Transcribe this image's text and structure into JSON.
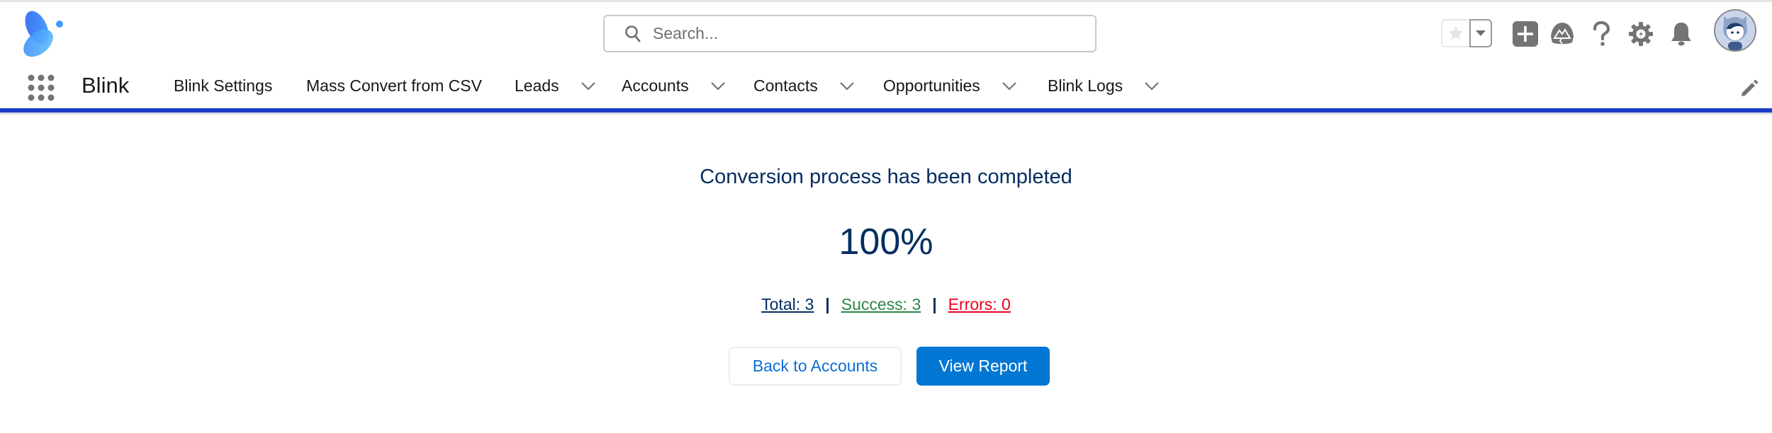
{
  "header": {
    "logo": "blink-butterfly-logo",
    "search": {
      "placeholder": "Search...",
      "value": ""
    },
    "icons": [
      "favorite-star-icon",
      "favorites-dropdown-icon",
      "global-create-icon",
      "trailhead-icon",
      "help-icon",
      "setup-gear-icon",
      "notifications-bell-icon",
      "user-avatar"
    ]
  },
  "nav": {
    "app_name": "Blink",
    "items": [
      {
        "label": "Blink Settings",
        "has_menu": false
      },
      {
        "label": "Mass Convert from CSV",
        "has_menu": false
      },
      {
        "label": "Leads",
        "has_menu": true
      },
      {
        "label": "Accounts",
        "has_menu": true
      },
      {
        "label": "Contacts",
        "has_menu": true
      },
      {
        "label": "Opportunities",
        "has_menu": true
      },
      {
        "label": "Blink Logs",
        "has_menu": true
      }
    ],
    "accent_color": "#1b3ec8"
  },
  "main": {
    "status_title": "Conversion process has been completed",
    "progress_percent": 100,
    "progress_label": "100%",
    "stats": {
      "total_label": "Total: 3",
      "total": 3,
      "success_label": "Success: 3",
      "success": 3,
      "errors_label": "Errors: 0",
      "errors": 0,
      "separator": "|"
    },
    "colors": {
      "title": "#032d60",
      "success": "#2e844a",
      "error": "#ea001e",
      "brand": "#0176d3"
    },
    "buttons": {
      "back_label": "Back to Accounts",
      "report_label": "View Report"
    }
  }
}
